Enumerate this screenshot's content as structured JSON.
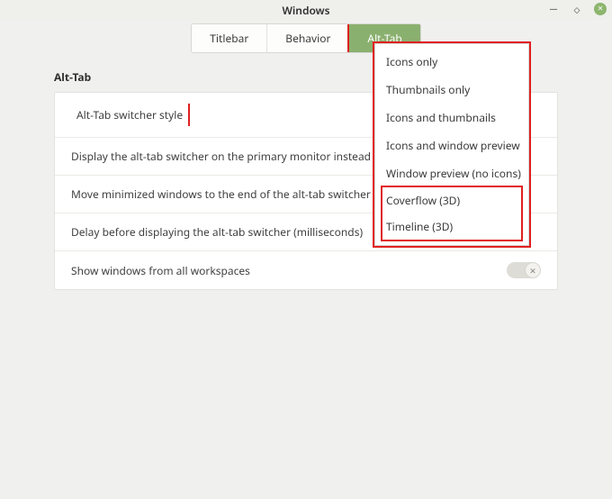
{
  "window": {
    "title": "Windows"
  },
  "tabs": {
    "titlebar": "Titlebar",
    "behavior": "Behavior",
    "alttab": "Alt-Tab"
  },
  "section": {
    "heading": "Alt-Tab"
  },
  "rows": {
    "style": "Alt-Tab switcher style",
    "primary": "Display the alt-tab switcher on the primary monitor instead of the",
    "minimized": "Move minimized windows to the end of the alt-tab switcher",
    "delay": "Delay before displaying the alt-tab switcher (milliseconds)",
    "workspaces": "Show windows from all workspaces"
  },
  "popup": {
    "icons_only": "Icons only",
    "thumbs_only": "Thumbnails only",
    "icons_thumbs": "Icons and thumbnails",
    "icons_preview": "Icons and window preview",
    "preview_noicons": "Window preview (no icons)",
    "coverflow": "Coverflow (3D)",
    "timeline": "Timeline (3D)"
  }
}
